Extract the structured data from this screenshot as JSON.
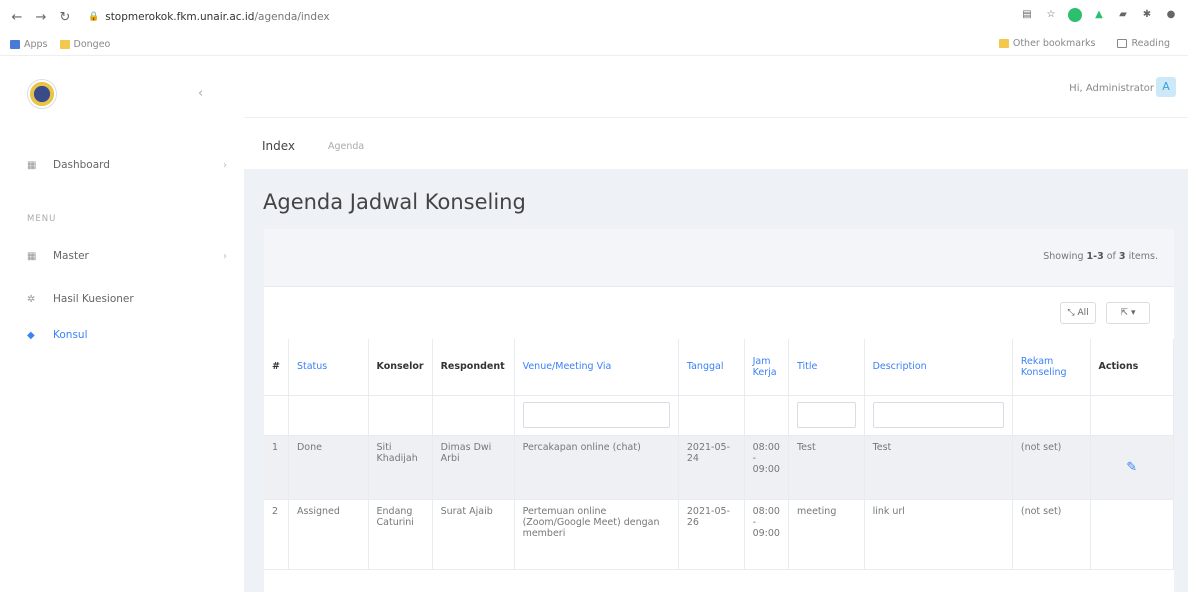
{
  "browser": {
    "url_host": "stopmerokok.fkm.unair.ac.id",
    "url_path": "/agenda/index",
    "bookmarks": [
      "Apps",
      "Dongeo"
    ],
    "bookmarks_right": [
      "Other bookmarks",
      "Reading"
    ]
  },
  "sidebar": {
    "items": [
      {
        "label": "Dashboard",
        "icon": "dashboard-icon"
      },
      {
        "label": "Master",
        "icon": "grid-icon"
      },
      {
        "label": "Hasil Kuesioner",
        "icon": "gear-icon"
      },
      {
        "label": "Konsul",
        "icon": "diamond-icon"
      }
    ],
    "menu_header": "MENU"
  },
  "header": {
    "greeting": "Hi, Administrator",
    "avatar_letter": "A"
  },
  "breadcrumb": {
    "current": "Index",
    "parent": "Agenda"
  },
  "main": {
    "title": "Agenda Jadwal Konseling",
    "summary_prefix": "Showing ",
    "summary_range": "1-3",
    "summary_mid": " of ",
    "summary_total": "3",
    "summary_suffix": " items.",
    "all_button": "All",
    "export_button": "▾"
  },
  "table": {
    "headers": {
      "num": "#",
      "status": "Status",
      "konselor": "Konselor",
      "respondent": "Respondent",
      "venue": "Venue/Meeting Via",
      "tanggal": "Tanggal",
      "jam": "Jam Kerja",
      "title": "Title",
      "description": "Description",
      "rekam": "Rekam Konseling",
      "actions": "Actions"
    },
    "rows": [
      {
        "num": "1",
        "status": "Done",
        "konselor": "Siti Khadijah",
        "respondent": "Dimas Dwi Arbi",
        "venue": "Percakapan online (chat)",
        "tanggal": "2021-05-24",
        "jam_start": "08:00",
        "jam_sep": "-",
        "jam_end": "09:00",
        "title": "Test",
        "description": "Test",
        "rekam": "(not set)"
      },
      {
        "num": "2",
        "status": "Assigned",
        "konselor": "Endang Caturini",
        "respondent": "Surat Ajaib",
        "venue": "Pertemuan online (Zoom/Google Meet) dengan memberi",
        "tanggal": "2021-05-26",
        "jam_start": "08:00",
        "jam_sep": "-",
        "jam_end": "09:00",
        "title": "meeting",
        "description": "link url",
        "rekam": "(not set)"
      }
    ]
  }
}
